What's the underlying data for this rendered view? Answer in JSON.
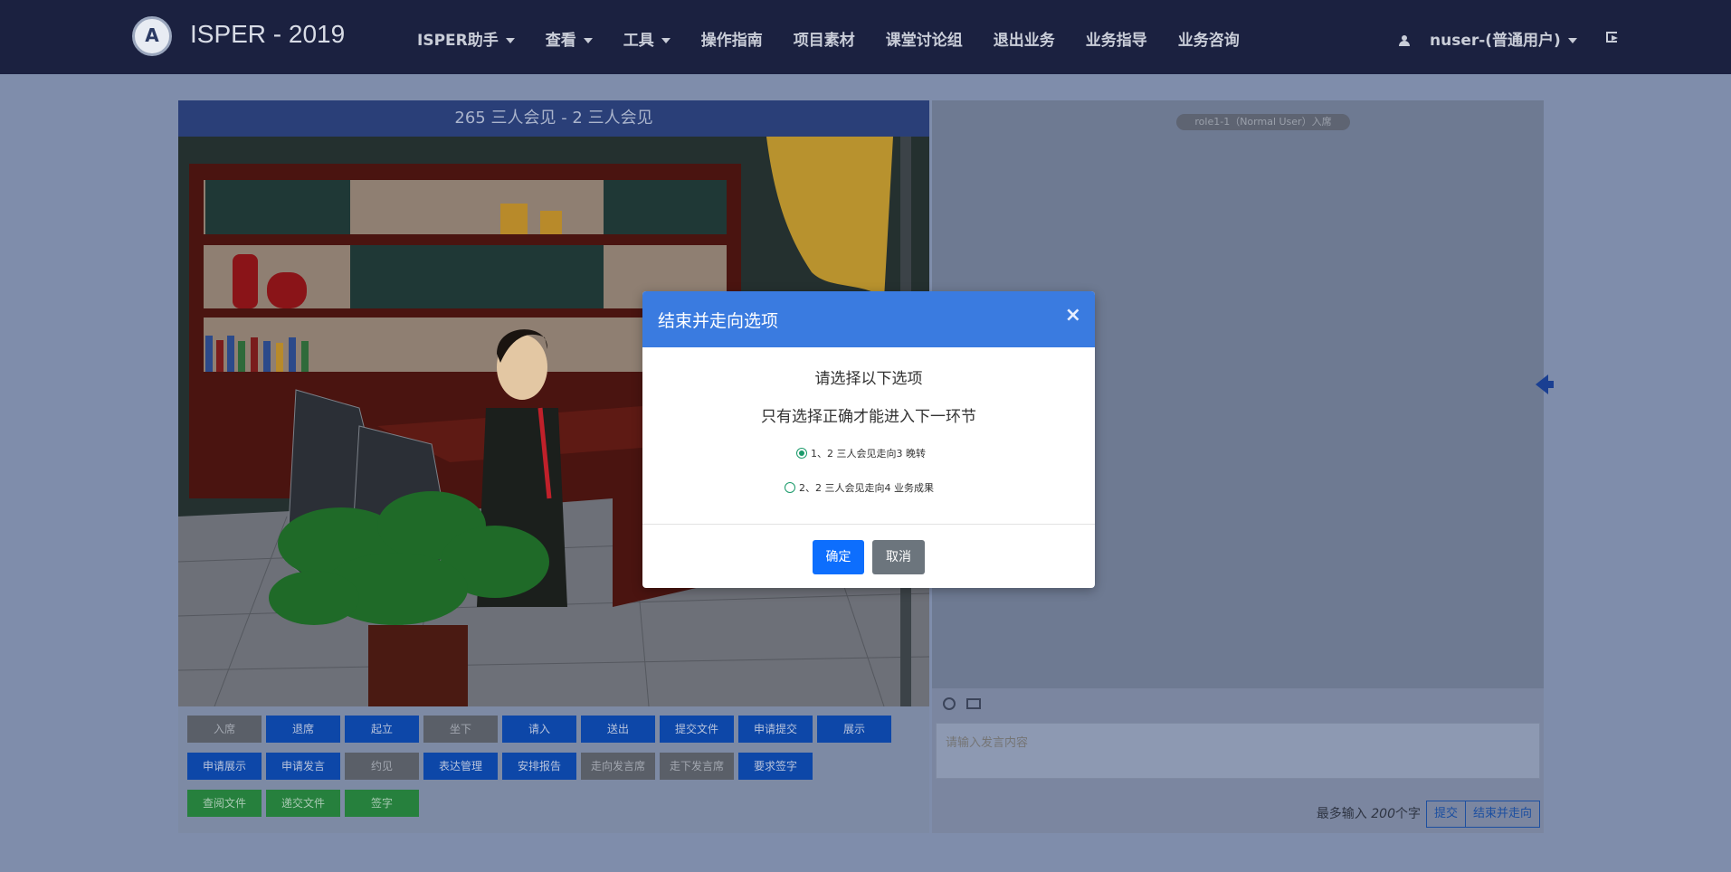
{
  "navbar": {
    "brand": "ISPER - 2019",
    "items": [
      {
        "label": "ISPER助手",
        "dropdown": true
      },
      {
        "label": "查看",
        "dropdown": true
      },
      {
        "label": "工具",
        "dropdown": true
      },
      {
        "label": "操作指南",
        "dropdown": false
      },
      {
        "label": "项目素材",
        "dropdown": false
      },
      {
        "label": "课堂讨论组",
        "dropdown": false
      },
      {
        "label": "退出业务",
        "dropdown": false
      },
      {
        "label": "业务指导",
        "dropdown": false
      },
      {
        "label": "业务咨询",
        "dropdown": false
      }
    ],
    "user": "nuser-(普通用户)"
  },
  "scene": {
    "title": "265 三人会见 - 2 三人会见"
  },
  "toolbar": {
    "buttons": [
      {
        "label": "入席",
        "style": "grey"
      },
      {
        "label": "退席",
        "style": "blue"
      },
      {
        "label": "起立",
        "style": "blue"
      },
      {
        "label": "坐下",
        "style": "grey"
      },
      {
        "label": "请入",
        "style": "blue"
      },
      {
        "label": "送出",
        "style": "blue"
      },
      {
        "label": "提交文件",
        "style": "blue"
      },
      {
        "label": "申请提交",
        "style": "blue"
      },
      {
        "label": "展示",
        "style": "blue"
      },
      {
        "label": "申请展示",
        "style": "blue"
      },
      {
        "label": "申请发言",
        "style": "blue"
      },
      {
        "label": "约见",
        "style": "grey"
      },
      {
        "label": "表达管理",
        "style": "blue"
      },
      {
        "label": "安排报告",
        "style": "blue"
      },
      {
        "label": "走向发言席",
        "style": "grey"
      },
      {
        "label": "走下发言席",
        "style": "grey"
      },
      {
        "label": "要求签字",
        "style": "blue"
      },
      {
        "label": "查阅文件",
        "style": "green"
      },
      {
        "label": "递交文件",
        "style": "green"
      },
      {
        "label": "签字",
        "style": "green"
      }
    ]
  },
  "chat": {
    "notice": "role1-1（Normal User）入席",
    "input_placeholder": "请输入发言内容",
    "limit_prefix": "最多输入 ",
    "limit_value": "200",
    "limit_suffix": "个字",
    "submit_label": "提交",
    "end_label": "结束并走向"
  },
  "modal": {
    "title": "结束并走向选项",
    "close": "×",
    "line1": "请选择以下选项",
    "line2": "只有选择正确才能进入下一环节",
    "options": [
      {
        "label": "1、2 三人会见走向3 晚转",
        "checked": true
      },
      {
        "label": "2、2 三人会见走向4 业务成果",
        "checked": false
      }
    ],
    "ok_label": "确定",
    "cancel_label": "取消"
  },
  "colors": {
    "navbar": "#1b2140",
    "modal_header": "#3a7be0",
    "primary": "#0d6efd",
    "secondary": "#6c757d"
  }
}
